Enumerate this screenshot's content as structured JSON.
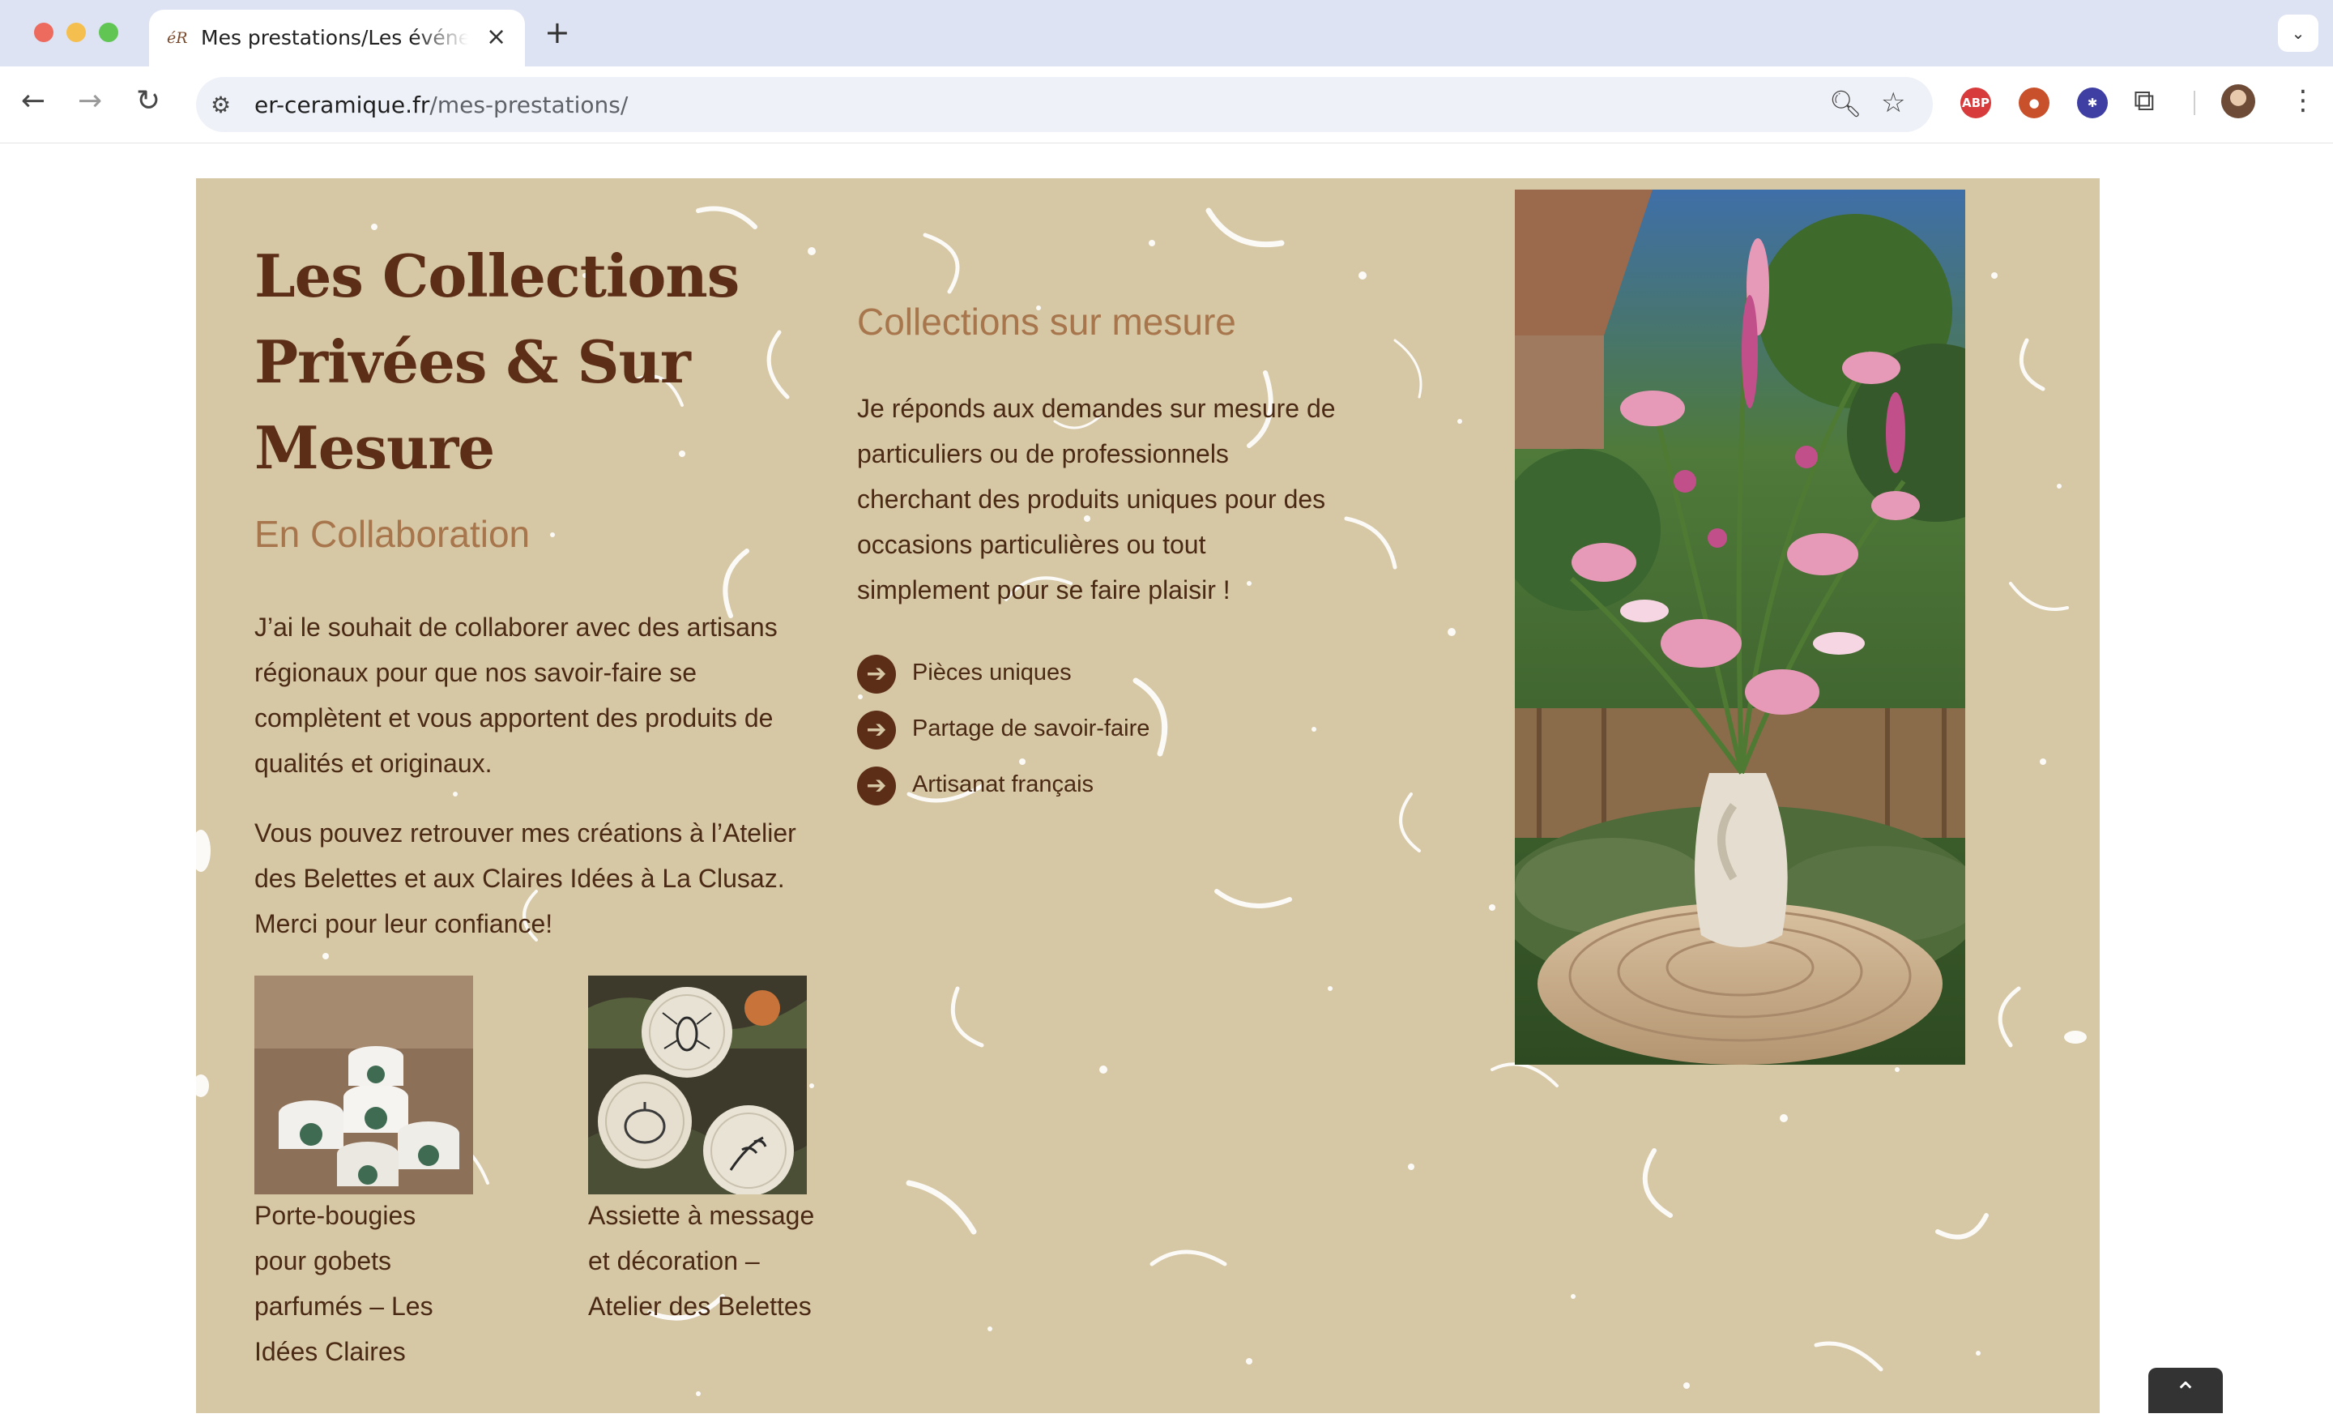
{
  "browser": {
    "tab_title": "Mes prestations/Les événements",
    "tab_favicon": "éR",
    "new_tab_label": "+",
    "url_domain": "er-ceramique.fr",
    "url_path": "/mes-prestations/",
    "extensions": [
      "ABP"
    ]
  },
  "page": {
    "title": "Les Collections Privées & Sur Mesure",
    "collab": {
      "heading": "En Collaboration",
      "paragraph1": "J’ai le souhait de collaborer avec des artisans régionaux pour que nos savoir-faire se complètent et vous apportent des produits de qualités et originaux.",
      "paragraph2": "Vous pouvez retrouver  mes créations à l’Atelier des Belettes et aux Claires Idées à La Clusaz. Merci pour leur confiance!"
    },
    "custom": {
      "heading": "Collections sur mesure",
      "paragraph": "Je réponds aux demandes sur mesure de particuliers ou de professionnels cherchant des produits uniques pour des occasions particulières ou tout simplement pour se faire plaisir !",
      "features": [
        "Pièces uniques",
        "Partage de savoir-faire",
        "Artisanat français"
      ]
    },
    "products": [
      {
        "caption": "Porte-bougies pour gobets parfumés – Les Idées Claires"
      },
      {
        "caption": "Assiette à message et décoration – Atelier des Belettes"
      }
    ]
  },
  "colors": {
    "section_bg": "#d6c7a5",
    "title": "#5c2e17",
    "subheading": "#a7764c",
    "body_text": "#4a2a14"
  },
  "icons": {
    "feature": "circle-arrow-right-icon",
    "scroll_top": "chevron-up-icon"
  }
}
